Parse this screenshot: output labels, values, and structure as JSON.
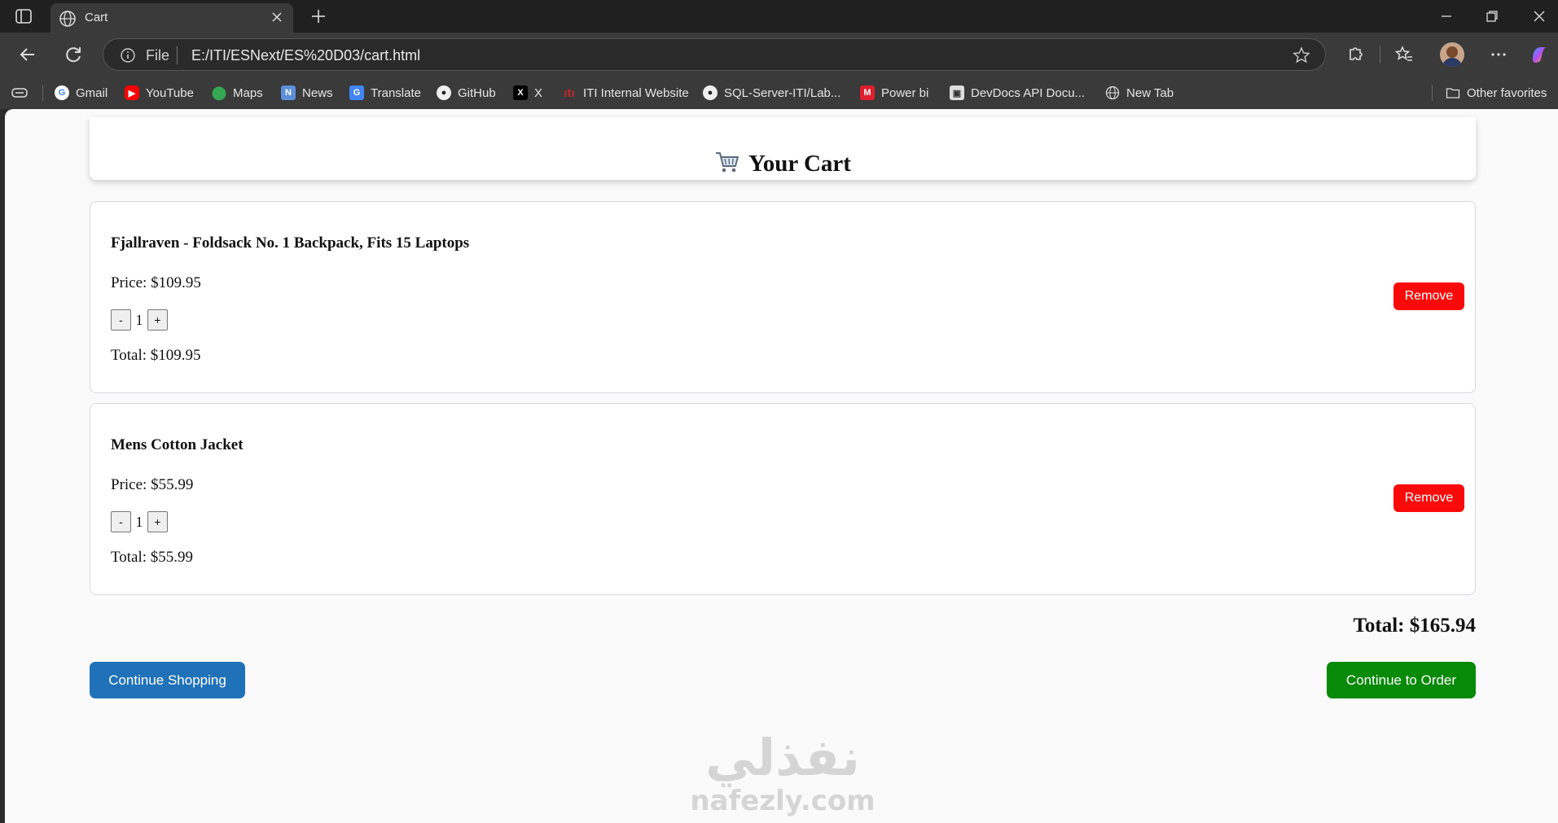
{
  "browser": {
    "tab_title": "Cart",
    "address_scheme": "File",
    "address_url": "E:/ITI/ESNext/ES%20D03/cart.html"
  },
  "bookmarks": [
    {
      "label": "Gmail",
      "icon": "gmail-icon"
    },
    {
      "label": "YouTube",
      "icon": "youtube-icon"
    },
    {
      "label": "Maps",
      "icon": "maps-icon"
    },
    {
      "label": "News",
      "icon": "news-icon"
    },
    {
      "label": "Translate",
      "icon": "translate-icon"
    },
    {
      "label": "GitHub",
      "icon": "github-icon"
    },
    {
      "label": "X",
      "icon": "x-icon"
    },
    {
      "label": "ITI Internal Website",
      "icon": "iti-icon"
    },
    {
      "label": "SQL-Server-ITI/Lab...",
      "icon": "github-icon"
    },
    {
      "label": "Power bi",
      "icon": "power-bi-icon"
    },
    {
      "label": "DevDocs API Docu...",
      "icon": "devdocs-icon"
    },
    {
      "label": "New Tab",
      "icon": "globe-icon"
    }
  ],
  "other_favorites": "Other favorites",
  "page": {
    "title": "Your Cart",
    "items": [
      {
        "name": "Fjallraven - Foldsack No. 1 Backpack, Fits 15 Laptops",
        "price": "Price: $109.95",
        "quantity": "1",
        "total": "Total: $109.95",
        "decrement": "-",
        "increment": "+",
        "remove": "Remove"
      },
      {
        "name": "Mens Cotton Jacket",
        "price": "Price: $55.99",
        "quantity": "1",
        "total": "Total: $55.99",
        "decrement": "-",
        "increment": "+",
        "remove": "Remove"
      }
    ],
    "grand_total": "Total: $165.94",
    "continue_shopping": "Continue Shopping",
    "continue_order": "Continue to Order"
  },
  "watermark": {
    "arabic": "نفذلي",
    "latin": "nafezly.com"
  },
  "colors": {
    "remove": "#fb0a0a",
    "continue_shopping": "#1f72b8",
    "continue_order": "#078a07"
  }
}
